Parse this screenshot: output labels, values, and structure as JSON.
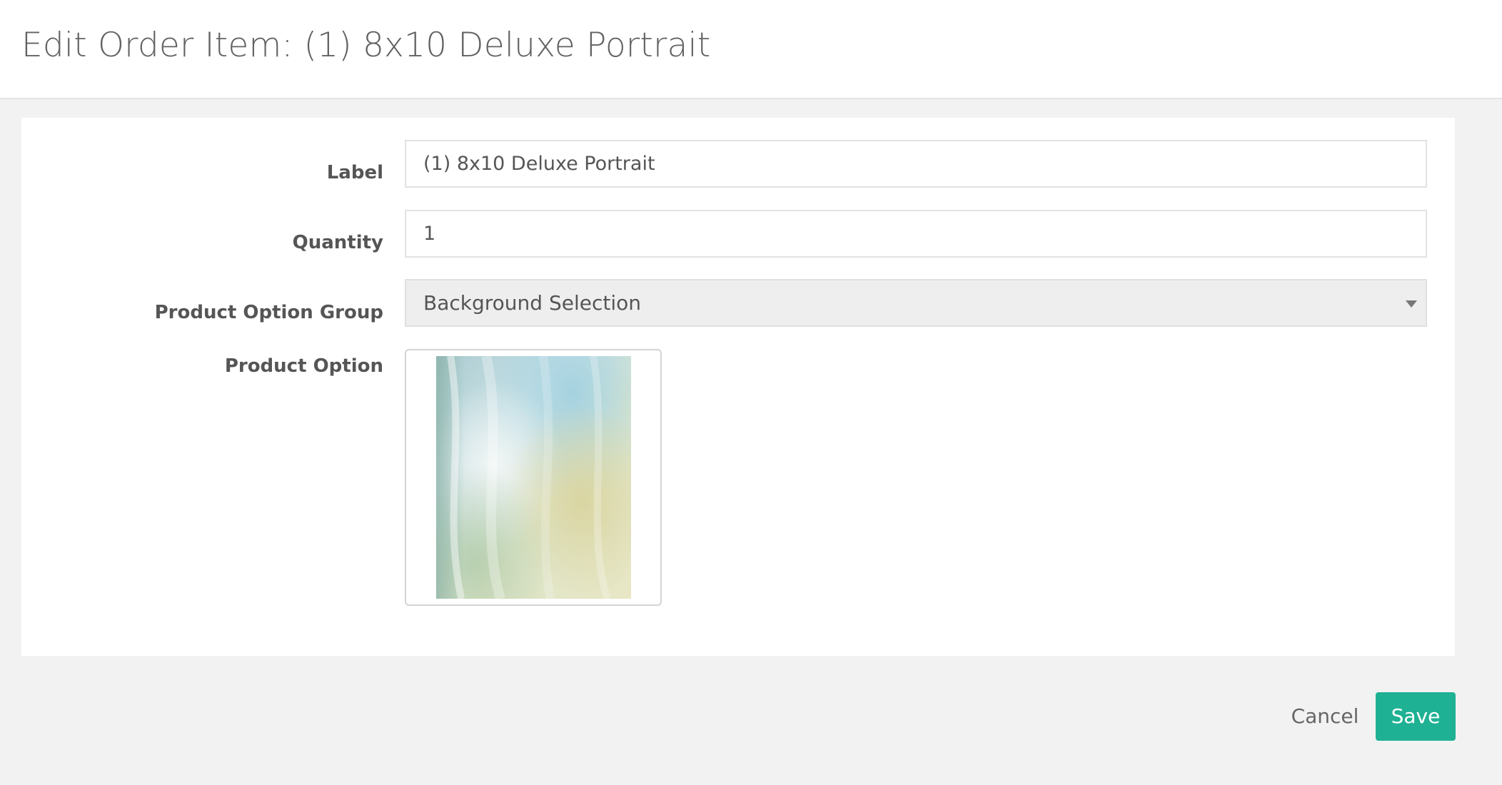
{
  "header": {
    "title": "Edit Order Item: (1) 8x10 Deluxe Portrait"
  },
  "form": {
    "label_field": {
      "label": "Label",
      "value": "(1) 8x10 Deluxe Portrait"
    },
    "quantity_field": {
      "label": "Quantity",
      "value": "1"
    },
    "option_group_field": {
      "label": "Product Option Group",
      "selected": "Background Selection"
    },
    "option_field": {
      "label": "Product Option",
      "thumbnail_icon": "background-swatch-icon"
    }
  },
  "footer": {
    "cancel_label": "Cancel",
    "save_label": "Save"
  },
  "colors": {
    "accent": "#1fb193",
    "page_background": "#f2f2f2",
    "panel_background": "#ffffff"
  }
}
